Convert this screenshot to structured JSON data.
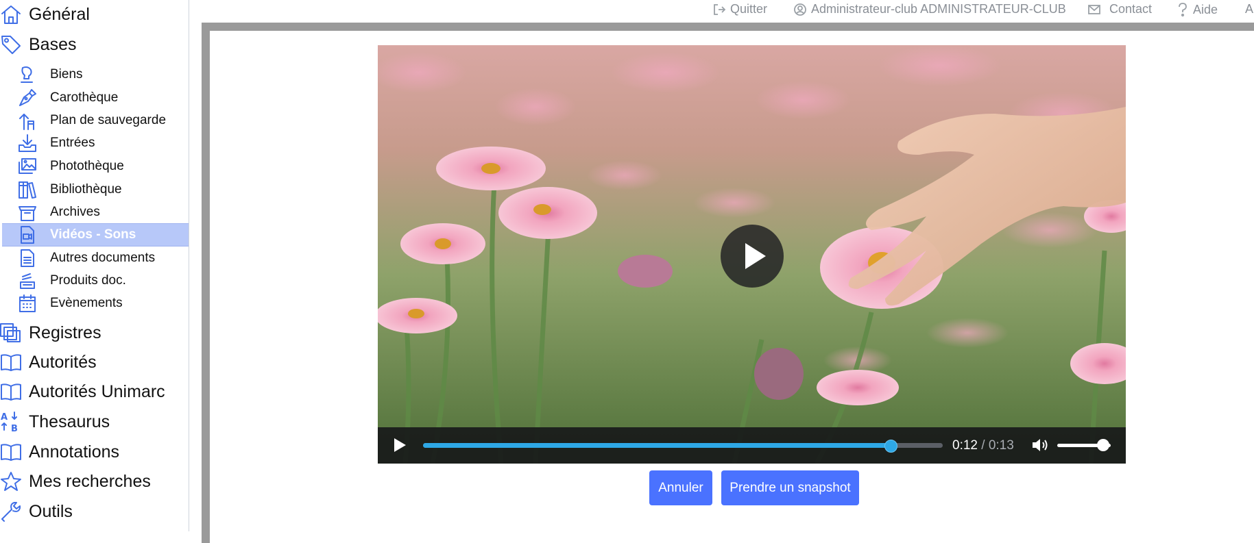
{
  "sidebar": {
    "main_items": [
      {
        "label": "Général",
        "icon": "home-icon"
      },
      {
        "label": "Bases",
        "icon": "tag-icon"
      }
    ],
    "sub_items": [
      {
        "label": "Biens",
        "icon": "bust-icon"
      },
      {
        "label": "Carothèque",
        "icon": "pen-nib-icon"
      },
      {
        "label": "Plan de sauvegarde",
        "icon": "dolly-icon"
      },
      {
        "label": "Entrées",
        "icon": "inbox-download-icon"
      },
      {
        "label": "Photothèque",
        "icon": "images-icon"
      },
      {
        "label": "Bibliothèque",
        "icon": "books-icon"
      },
      {
        "label": "Archives",
        "icon": "box-icon"
      },
      {
        "label": "Vidéos - Sons",
        "icon": "video-file-icon",
        "active": true
      },
      {
        "label": "Autres documents",
        "icon": "document-icon"
      },
      {
        "label": "Produits doc.",
        "icon": "stack-icon"
      },
      {
        "label": "Evènements",
        "icon": "calendar-icon"
      }
    ],
    "bottom_items": [
      {
        "label": "Registres",
        "icon": "registers-icon"
      },
      {
        "label": "Autorités",
        "icon": "open-book-icon"
      },
      {
        "label": "Autorités Unimarc",
        "icon": "open-book-icon"
      },
      {
        "label": "Thesaurus",
        "icon": "sort-alpha-icon"
      },
      {
        "label": "Annotations",
        "icon": "open-book-icon"
      },
      {
        "label": "Mes recherches",
        "icon": "star-icon"
      },
      {
        "label": "Outils",
        "icon": "wrench-icon"
      }
    ],
    "active_color": "#b7c8f9",
    "icon_color": "#3f6ee6"
  },
  "topbar": {
    "quit": "Quitter",
    "user": "Administrateur-club ADMINISTRATEUR-CLUB",
    "contact": "Contact",
    "help": "Aide",
    "overflow": "A"
  },
  "video": {
    "current_time": "0:12",
    "separator": "/",
    "duration": "0:13",
    "progress_fraction": 0.9,
    "volume_fraction": 0.86,
    "accent": "#2ea8e6"
  },
  "buttons": {
    "cancel": "Annuler",
    "snapshot": "Prendre un snapshot",
    "color": "#4a72ff"
  }
}
